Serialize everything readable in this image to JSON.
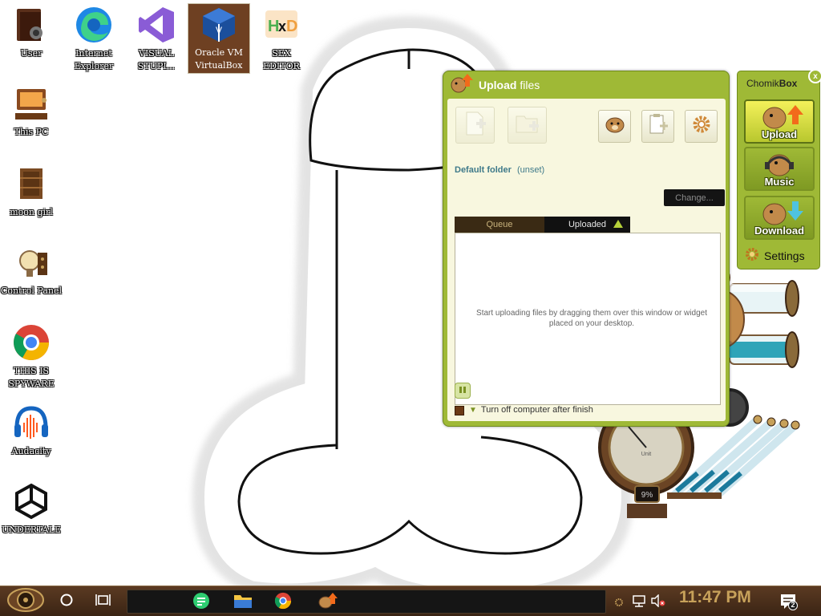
{
  "desktop": {
    "icons": [
      {
        "label": "User",
        "icon": "user-folder-icon"
      },
      {
        "label": "Internet\nExplorer",
        "icon": "edge-icon"
      },
      {
        "label": "VISUAL\nSTUPI...",
        "icon": "visual-studio-icon"
      },
      {
        "label": "Oracle VM\nVirtualBox",
        "icon": "virtualbox-icon"
      },
      {
        "label": "SEX\nEDITOR",
        "icon": "hxd-icon"
      },
      {
        "label": "This PC",
        "icon": "computer-icon"
      },
      {
        "label": "moon girl",
        "icon": "crate-icon"
      },
      {
        "label": "Control Panel",
        "icon": "control-panel-icon"
      },
      {
        "label": "THIS IS\nSPYWARE",
        "icon": "chrome-icon"
      },
      {
        "label": "Audacity",
        "icon": "audacity-icon"
      },
      {
        "label": "UNDERTALE",
        "icon": "unity-icon"
      }
    ]
  },
  "upload_window": {
    "title_bold": "Upload",
    "title_rest": " files",
    "toolbar": [
      "add-file-icon",
      "add-folder-icon",
      "chomik-icon",
      "clipboard-add-icon",
      "gear-icon"
    ],
    "default_folder_label": "Default folder",
    "default_folder_value": "(unset)",
    "change_button": "Change...",
    "tabs": {
      "queue": "Queue",
      "uploaded": "Uploaded"
    },
    "empty_message": "Start uploading files by dragging them over this window or widget placed on your desktop.",
    "turn_off_label": "Turn off computer after finish"
  },
  "chomikbox": {
    "title_light": "Chomik",
    "title_bold": "Box",
    "close": "x",
    "buttons": {
      "upload": "Upload",
      "music": "Music",
      "download": "Download"
    },
    "settings": "Settings"
  },
  "gauge": {
    "percent": "9%"
  },
  "taskbar": {
    "apps": [
      "notes-icon",
      "file-explorer-icon",
      "chrome-icon",
      "chomikbox-icon"
    ],
    "clock": "11:47 PM",
    "notifications": "2"
  },
  "colors": {
    "accent_green": "#9fb936",
    "taskbar_brown": "#4a2e1a",
    "clock_gold": "#c7a15a"
  }
}
